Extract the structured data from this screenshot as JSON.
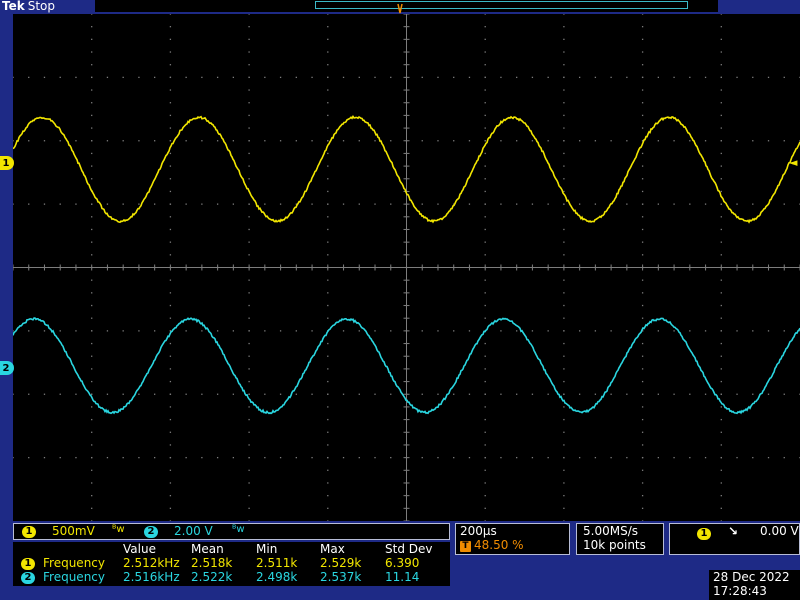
{
  "header": {
    "brand": "Tek",
    "status": "Stop"
  },
  "markers": {
    "ch1": "1",
    "ch2": "2",
    "trigger_pos": "T",
    "trigger_level": "◄"
  },
  "channels": {
    "ch1": {
      "num": "1",
      "scale": "500mV",
      "coupling_icon": "bandwidth-limit-icon",
      "color": "#f2e600"
    },
    "ch2": {
      "num": "2",
      "scale": "2.00 V",
      "coupling_icon": "bandwidth-limit-icon",
      "color": "#2ad6e0"
    }
  },
  "timebase": {
    "scale": "200µs",
    "trigger_pos_label": "T",
    "trigger_pos": "48.50 %"
  },
  "acquisition": {
    "rate": "5.00MS/s",
    "points": "10k points"
  },
  "trigger": {
    "source": "1",
    "slope_symbol": "⌐",
    "level": "0.00 V"
  },
  "datetime": {
    "date": "28 Dec  2022",
    "time": "17:28:43"
  },
  "measurements": {
    "headers": [
      "Value",
      "Mean",
      "Min",
      "Max",
      "Std Dev"
    ],
    "rows": [
      {
        "ch": "1",
        "name": "Frequency",
        "value": "2.512kHz",
        "mean": "2.518k",
        "min": "2.511k",
        "max": "2.529k",
        "std": "6.390"
      },
      {
        "ch": "2",
        "name": "Frequency",
        "value": "2.516kHz",
        "mean": "2.522k",
        "min": "2.498k",
        "max": "2.537k",
        "std": "11.14"
      }
    ]
  },
  "waveforms": {
    "ch1": {
      "frequency_khz": 2.512,
      "amplitude_div": 1.0,
      "offset_div": 1.0
    },
    "ch2": {
      "frequency_khz": 2.516,
      "amplitude_div": 0.9,
      "offset_div": -1.0
    }
  },
  "colors": {
    "frame": "#1e2a86",
    "grid": "#7d7d7d",
    "ch1": "#f2e600",
    "ch2": "#2ad6e0",
    "trigger": "#f08c00"
  }
}
